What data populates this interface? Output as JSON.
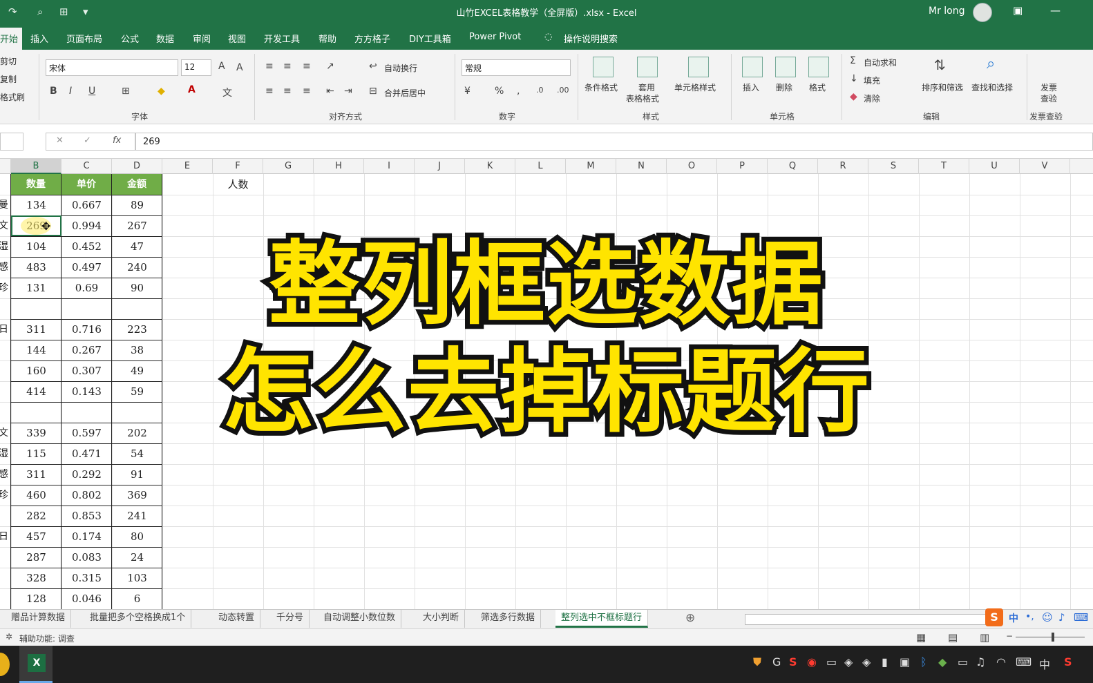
{
  "window": {
    "title": "山竹EXCEL表格教学（全屏版）.xlsx  -  Excel",
    "user": "Mr long"
  },
  "ribbon_tabs": [
    "开始",
    "插入",
    "页面布局",
    "公式",
    "数据",
    "审阅",
    "视图",
    "开发工具",
    "帮助",
    "方方格子",
    "DIY工具箱",
    "Power Pivot",
    "操作说明搜索"
  ],
  "clipboard": {
    "cut": "剪切",
    "copy": "复制",
    "painter": "格式刷"
  },
  "font": {
    "name": "宋体",
    "size": "12",
    "group": "字体"
  },
  "alignment": {
    "wrap": "自动换行",
    "merge": "合并后居中",
    "group": "对齐方式"
  },
  "number": {
    "format": "常规",
    "group": "数字"
  },
  "styles": {
    "cond": "条件格式",
    "table1": "套用",
    "table2": "表格格式",
    "cell": "单元格样式",
    "group": "样式"
  },
  "cells": {
    "insert": "插入",
    "delete": "删除",
    "format": "格式",
    "group": "单元格"
  },
  "editing": {
    "autosum": "自动求和",
    "fill": "填充",
    "clear": "清除",
    "sort": "排序和筛选",
    "find": "查找和选择",
    "group": "编辑"
  },
  "invoice": {
    "btn1": "发票",
    "btn2": "查验",
    "group": "发票查验"
  },
  "formula_bar": {
    "value": "269"
  },
  "columns": [
    "B",
    "C",
    "D",
    "E",
    "F",
    "G",
    "H",
    "I",
    "J",
    "K",
    "L",
    "M",
    "N",
    "O",
    "P",
    "Q",
    "R",
    "S",
    "T",
    "U",
    "V"
  ],
  "table_headers": [
    "数量",
    "单价",
    "金额"
  ],
  "f1_label": "人数",
  "rows": [
    {
      "edge": "曼",
      "b": "134",
      "c": "0.667",
      "d": "89"
    },
    {
      "edge": "文",
      "b": "269",
      "c": "0.994",
      "d": "267"
    },
    {
      "edge": "湿",
      "b": "104",
      "c": "0.452",
      "d": "47"
    },
    {
      "edge": "感",
      "b": "483",
      "c": "0.497",
      "d": "240"
    },
    {
      "edge": "珍",
      "b": "131",
      "c": "0.69",
      "d": "90"
    },
    {
      "edge": "",
      "b": "",
      "c": "",
      "d": ""
    },
    {
      "edge": "日",
      "b": "311",
      "c": "0.716",
      "d": "223"
    },
    {
      "edge": "",
      "b": "144",
      "c": "0.267",
      "d": "38"
    },
    {
      "edge": "",
      "b": "160",
      "c": "0.307",
      "d": "49"
    },
    {
      "edge": "",
      "b": "414",
      "c": "0.143",
      "d": "59"
    },
    {
      "edge": "",
      "b": "",
      "c": "",
      "d": ""
    },
    {
      "edge": "文",
      "b": "339",
      "c": "0.597",
      "d": "202"
    },
    {
      "edge": "湿",
      "b": "115",
      "c": "0.471",
      "d": "54"
    },
    {
      "edge": "感",
      "b": "311",
      "c": "0.292",
      "d": "91"
    },
    {
      "edge": "珍",
      "b": "460",
      "c": "0.802",
      "d": "369"
    },
    {
      "edge": "",
      "b": "282",
      "c": "0.853",
      "d": "241"
    },
    {
      "edge": "日",
      "b": "457",
      "c": "0.174",
      "d": "80"
    },
    {
      "edge": "",
      "b": "287",
      "c": "0.083",
      "d": "24"
    },
    {
      "edge": "",
      "b": "328",
      "c": "0.315",
      "d": "103"
    },
    {
      "edge": "",
      "b": "128",
      "c": "0.046",
      "d": "6"
    }
  ],
  "overlay": {
    "line1": "整列框选数据",
    "line2": "怎么去掉标题行"
  },
  "sheet_tabs": [
    "赠品计算数据",
    "批量把多个空格换成1个",
    "动态转置",
    "千分号",
    "自动调整小数位数",
    "大小判断",
    "筛选多行数据",
    "整列选中不框标题行"
  ],
  "status": {
    "accessibility": "辅助功能: 调查"
  },
  "taskbar": {
    "ime": "中"
  },
  "colors": {
    "excel_green": "#217346",
    "header_fill": "#70ad47",
    "overlay_text": "#ffe400"
  }
}
